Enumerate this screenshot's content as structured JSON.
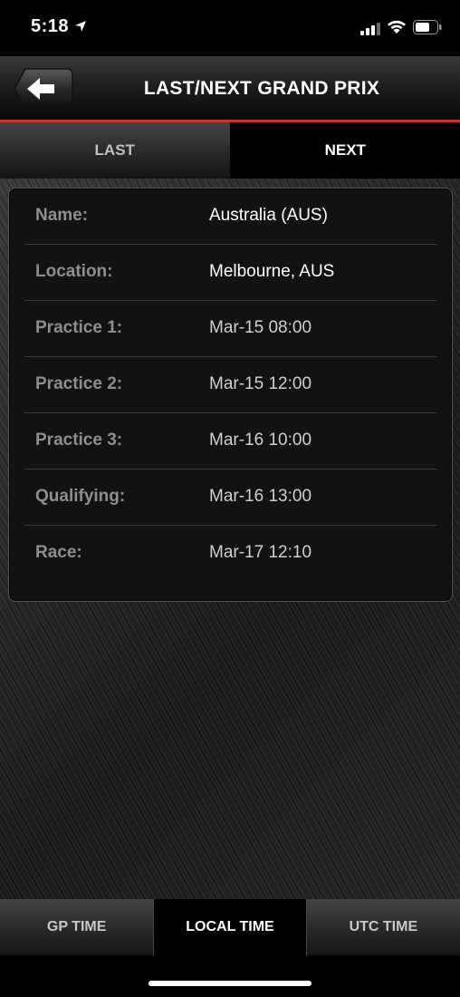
{
  "status_bar": {
    "time": "5:18"
  },
  "nav": {
    "title": "LAST/NEXT GRAND PRIX"
  },
  "top_tabs": [
    {
      "label": "LAST",
      "active": false
    },
    {
      "label": "NEXT",
      "active": true
    }
  ],
  "details": [
    {
      "label": "Name:",
      "value": "Australia (AUS)"
    },
    {
      "label": "Location:",
      "value": "Melbourne, AUS"
    },
    {
      "label": "Practice 1:",
      "value": "Mar-15 08:00"
    },
    {
      "label": "Practice 2:",
      "value": "Mar-15 12:00"
    },
    {
      "label": "Practice 3:",
      "value": "Mar-16 10:00"
    },
    {
      "label": "Qualifying:",
      "value": "Mar-16 13:00"
    },
    {
      "label": "Race:",
      "value": "Mar-17 12:10"
    }
  ],
  "bottom_tabs": [
    {
      "label": "GP TIME",
      "active": false
    },
    {
      "label": "LOCAL TIME",
      "active": true
    },
    {
      "label": "UTC TIME",
      "active": false
    }
  ],
  "colors": {
    "accent": "#c0392b"
  }
}
